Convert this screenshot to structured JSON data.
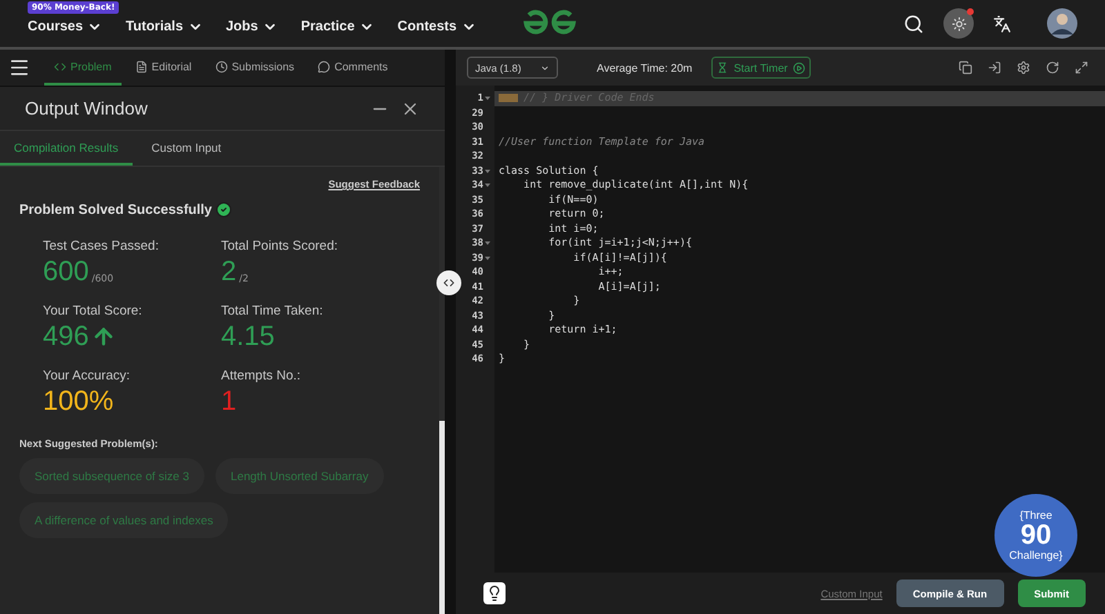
{
  "nav": {
    "promo": "90% Money-Back!",
    "menus": [
      {
        "label": "Courses"
      },
      {
        "label": "Tutorials"
      },
      {
        "label": "Jobs"
      },
      {
        "label": "Practice"
      },
      {
        "label": "Contests"
      }
    ],
    "theme_notification": true
  },
  "problem_tabs": [
    {
      "label": "Problem",
      "selected": true
    },
    {
      "label": "Editorial",
      "selected": false
    },
    {
      "label": "Submissions",
      "selected": false
    },
    {
      "label": "Comments",
      "selected": false
    }
  ],
  "output_window": {
    "title": "Output Window",
    "tabs": [
      {
        "label": "Compilation Results",
        "selected": true
      },
      {
        "label": "Custom Input",
        "selected": false
      }
    ],
    "feedback_link": "Suggest Feedback",
    "status": "Problem Solved Successfully",
    "stats": [
      {
        "label": "Test Cases Passed:",
        "value": "600",
        "suffix": "/600",
        "color": "#2f9e55",
        "rising": false
      },
      {
        "label": "Total Points Scored:",
        "value": "2",
        "suffix": "/2",
        "color": "#2f9e55",
        "rising": false
      },
      {
        "label": "Your Total Score:",
        "value": "496",
        "color": "#2f9e55",
        "rising": true
      },
      {
        "label": "Total Time Taken:",
        "value": "4.15",
        "color": "#2f9e55",
        "rising": false
      },
      {
        "label": "Your Accuracy:",
        "value": "100%",
        "color": "#f2b51b",
        "rising": false
      },
      {
        "label": "Attempts No.:",
        "value": "1",
        "color": "#e02020",
        "rising": false
      }
    ],
    "suggested_heading": "Next Suggested Problem(s):",
    "suggested": [
      "Sorted subsequence of size 3",
      "Length Unsorted Subarray",
      "A difference of values and indexes"
    ]
  },
  "editor": {
    "language": "Java (1.8)",
    "average_time": "Average Time: 20m",
    "timer_button": "Start Timer",
    "lines": [
      {
        "num": "1",
        "text": "// } Driver Code Ends",
        "kind": "banner",
        "foldable": true
      },
      {
        "num": "29",
        "kind": "code",
        "foldable": false
      },
      {
        "num": "30",
        "kind": "code",
        "foldable": false
      },
      {
        "num": "31",
        "text": "//User function Template for Java",
        "kind": "comment",
        "foldable": false
      },
      {
        "num": "32",
        "kind": "code",
        "foldable": false
      },
      {
        "num": "33",
        "text": "class Solution {",
        "kind": "code",
        "foldable": true
      },
      {
        "num": "34",
        "text": "    int remove_duplicate(int A[],int N){",
        "kind": "code",
        "foldable": true
      },
      {
        "num": "35",
        "text": "        if(N==0)",
        "kind": "code",
        "foldable": false
      },
      {
        "num": "36",
        "text": "        return 0;",
        "kind": "code",
        "foldable": false
      },
      {
        "num": "37",
        "text": "        int i=0;",
        "kind": "code",
        "foldable": false
      },
      {
        "num": "38",
        "text": "        for(int j=i+1;j<N;j++){",
        "kind": "code",
        "foldable": true
      },
      {
        "num": "39",
        "text": "            if(A[i]!=A[j]){",
        "kind": "code",
        "foldable": true
      },
      {
        "num": "40",
        "text": "                i++;",
        "kind": "code",
        "foldable": false
      },
      {
        "num": "41",
        "text": "                A[i]=A[j];",
        "kind": "code",
        "foldable": false
      },
      {
        "num": "42",
        "text": "            }",
        "kind": "code",
        "foldable": false
      },
      {
        "num": "43",
        "text": "        }",
        "kind": "code",
        "foldable": false
      },
      {
        "num": "44",
        "text": "        return i+1;",
        "kind": "code",
        "foldable": false
      },
      {
        "num": "45",
        "text": "    }",
        "kind": "code",
        "foldable": false
      },
      {
        "num": "46",
        "text": "}",
        "kind": "code",
        "foldable": false
      }
    ],
    "custom_input_link": "Custom Input",
    "compile_button": "Compile & Run",
    "submit_button": "Submit"
  },
  "challenge_badge": {
    "top": "{Three",
    "number": "90",
    "bottom": "Challenge}"
  }
}
